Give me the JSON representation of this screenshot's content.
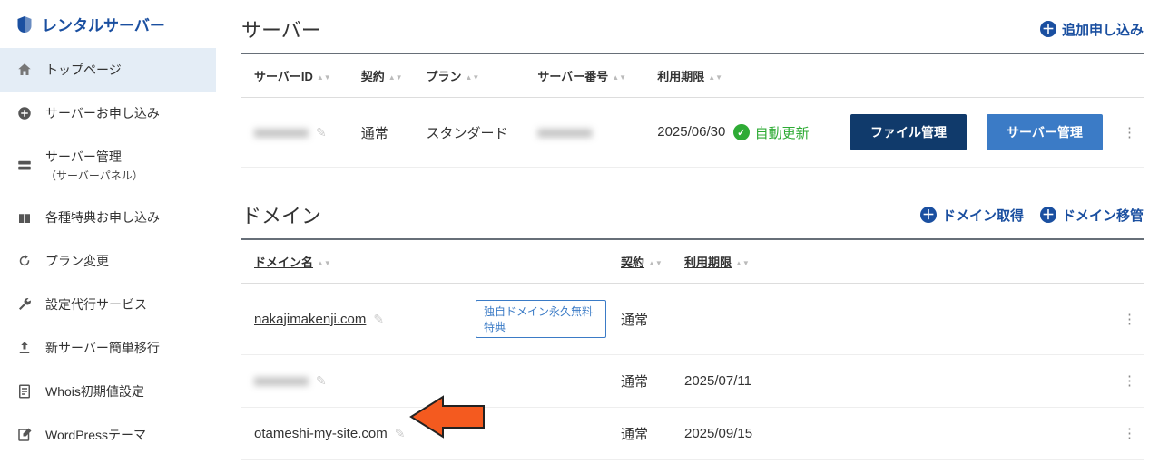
{
  "brand": {
    "title": "レンタルサーバー"
  },
  "sidebar": {
    "items": [
      {
        "label": "トップページ",
        "icon": "home-icon",
        "active": true
      },
      {
        "label": "サーバーお申し込み",
        "icon": "plus-circle-icon"
      },
      {
        "label": "サーバー管理",
        "sub": "（サーバーパネル）",
        "icon": "server-icon"
      },
      {
        "label": "各種特典お申し込み",
        "icon": "gift-icon"
      },
      {
        "label": "プラン変更",
        "icon": "refresh-icon"
      },
      {
        "label": "設定代行サービス",
        "icon": "wrench-icon"
      },
      {
        "label": "新サーバー簡単移行",
        "icon": "upload-icon"
      },
      {
        "label": "Whois初期値設定",
        "icon": "note-icon"
      },
      {
        "label": "WordPressテーマ",
        "icon": "edit-icon"
      }
    ]
  },
  "servers": {
    "title": "サーバー",
    "add_label": "追加申し込み",
    "columns": {
      "id": "サーバーID",
      "contract": "契約",
      "plan": "プラン",
      "number": "サーバー番号",
      "expiry": "利用期限"
    },
    "rows": [
      {
        "id_masked": "xxxxxxxx",
        "contract": "通常",
        "plan": "スタンダード",
        "number_masked": "xxxxxxxx",
        "expiry": "2025/06/30",
        "status": "自動更新",
        "btn_file": "ファイル管理",
        "btn_server": "サーバー管理"
      }
    ]
  },
  "domains": {
    "title": "ドメイン",
    "action_get": "ドメイン取得",
    "action_transfer": "ドメイン移管",
    "columns": {
      "name": "ドメイン名",
      "contract": "契約",
      "expiry": "利用期限"
    },
    "rows": [
      {
        "name": "nakajimakenji.com",
        "masked": false,
        "badge": "独自ドメイン永久無料特典",
        "contract": "通常",
        "expiry": ""
      },
      {
        "name": "xxxxxxxx",
        "masked": true,
        "badge": "",
        "contract": "通常",
        "expiry": "2025/07/11"
      },
      {
        "name": "otameshi-my-site.com",
        "masked": false,
        "badge": "",
        "contract": "通常",
        "expiry": "2025/09/15"
      }
    ]
  }
}
